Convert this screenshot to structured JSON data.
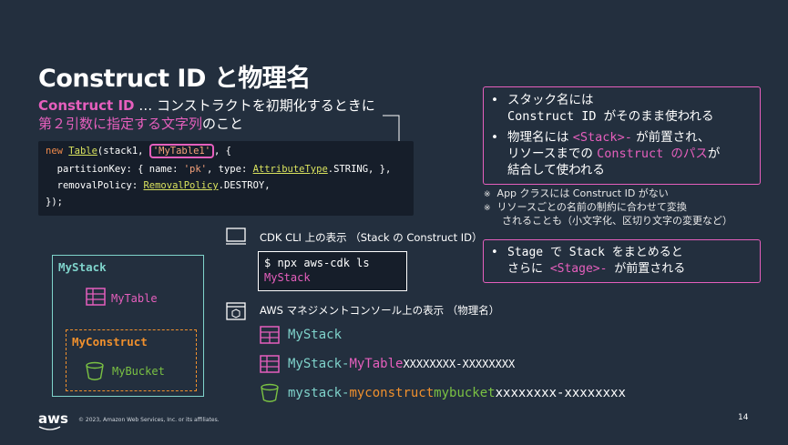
{
  "title": "Construct ID と物理名",
  "definition": {
    "term": "Construct ID",
    "text1": " … コンストラクトを初期化するときに",
    "highlight": "第２引数に指定する文字列",
    "text2": "のこと"
  },
  "code": {
    "l1_new": "new ",
    "l1_type": "Table",
    "l1_mid": "(stack1, ",
    "l1_str": "'MyTable1'",
    "l1_end": ", {",
    "l2_key": "  partitionKey: { name: ",
    "l2_str": "'pk'",
    "l2_mid": ", type: ",
    "l2_type": "AttributeType",
    "l2_end": ".STRING, },",
    "l3_key": "  removalPolicy: ",
    "l3_type": "RemovalPolicy",
    "l3_end": ".DESTROY,",
    "l4": "});"
  },
  "box1": {
    "b1_line1": "スタック名には",
    "b1_line2": "Construct ID がそのまま使われる",
    "b2_line1a": "物理名には ",
    "b2_line1b": "<Stack>-",
    "b2_line1c": " が前置され、",
    "b2_line2a": "リソースまでの ",
    "b2_line2b": "Construct のパス",
    "b2_line2c": "が",
    "b2_line3": "結合して使われる"
  },
  "notes": {
    "n1": "App クラスには Construct ID がない",
    "n2": "リソースごとの名前の制約に合わせて変換",
    "n3": "されることも（小文字化、区切り文字の変更など）"
  },
  "box2": {
    "line1": "Stage で Stack をまとめると",
    "line2a": "さらに ",
    "line2b": "<Stage>-",
    "line2c": " が前置される"
  },
  "tree": {
    "stack": "MyStack",
    "table": "MyTable",
    "construct": "MyConstruct",
    "bucket": "MyBucket"
  },
  "cli": {
    "heading": "CDK CLI 上の表示 （Stack の Construct ID）",
    "cmd": "$ npx aws-cdk ls",
    "out": "MyStack"
  },
  "console": {
    "heading": "AWS マネジメントコンソール上の表示 （物理名）",
    "r1": "MyStack",
    "r2a": "MyStack-",
    "r2b": "MyTable",
    "r2c": "XXXXXXXX-XXXXXXXX",
    "r3a": "mystack-",
    "r3b": "myconstruct",
    "r3c": "mybucket",
    "r3d": "xxxxxxxx-xxxxxxxx"
  },
  "footer": {
    "logo": "aws",
    "copyright": "© 2023, Amazon Web Services, Inc. or its affiliates.",
    "page": "14"
  },
  "colors": {
    "bg": "#232f3e",
    "pink": "#e65fbd",
    "cyan": "#7fd3cb",
    "orange": "#f0902d",
    "green": "#7ac143"
  }
}
